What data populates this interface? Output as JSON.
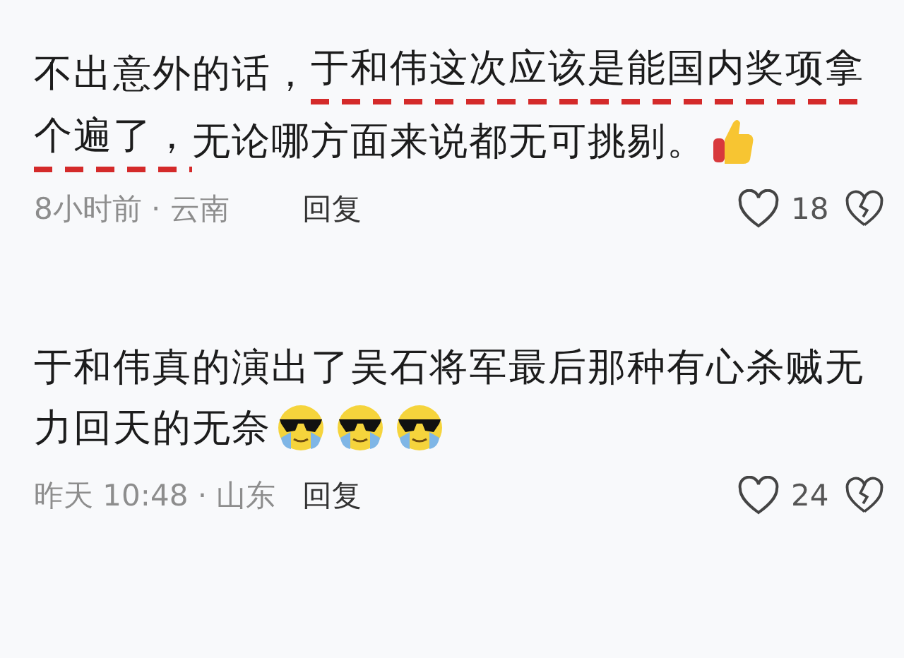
{
  "comments": [
    {
      "lines": [
        [
          {
            "kind": "text",
            "text": "不出意外的话，",
            "underlined": false
          },
          {
            "kind": "text",
            "text": "于和伟这次应该是能国内奖项拿",
            "underlined": true
          }
        ],
        [
          {
            "kind": "text",
            "text": "个遍了，",
            "underlined": true
          },
          {
            "kind": "text",
            "text": "无论哪方面来说都无可挑剔。",
            "underlined": false
          },
          {
            "kind": "thumb"
          }
        ]
      ],
      "meta": "8小时前 · 云南",
      "reply": "回复",
      "likes": "18"
    },
    {
      "lines": [
        [
          {
            "kind": "text",
            "text": "于和伟真的演出了吴石将军最后那种有心杀贼无",
            "underlined": false
          }
        ],
        [
          {
            "kind": "text",
            "text": "力回天的无奈",
            "underlined": false
          },
          {
            "kind": "shades"
          },
          {
            "kind": "shades"
          },
          {
            "kind": "shades"
          }
        ]
      ],
      "meta": "昨天 10:48 · 山东",
      "reply": "回复",
      "likes": "24"
    }
  ]
}
